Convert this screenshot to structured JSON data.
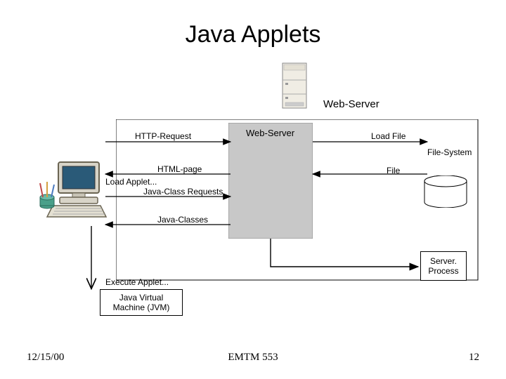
{
  "title": "Java Applets",
  "labels": {
    "web_server_top": "Web-Server",
    "web_server_inner": "Web-Server",
    "http_request": "HTTP-Request",
    "load_file": "Load File",
    "file_system": "File-System",
    "html_page": "HTML-page",
    "load_applet": "Load Applet...",
    "file": "File",
    "java_class_requests": "Java-Class Requests",
    "java_classes": "Java-Classes",
    "execute_applet": "Execute Applet...",
    "server_process": "Server.\nProcess"
  },
  "boxes": {
    "jvm": "Java Virtual\nMachine (JVM)"
  },
  "footer": {
    "date": "12/15/00",
    "center": "EMTM 553",
    "page": "12"
  }
}
